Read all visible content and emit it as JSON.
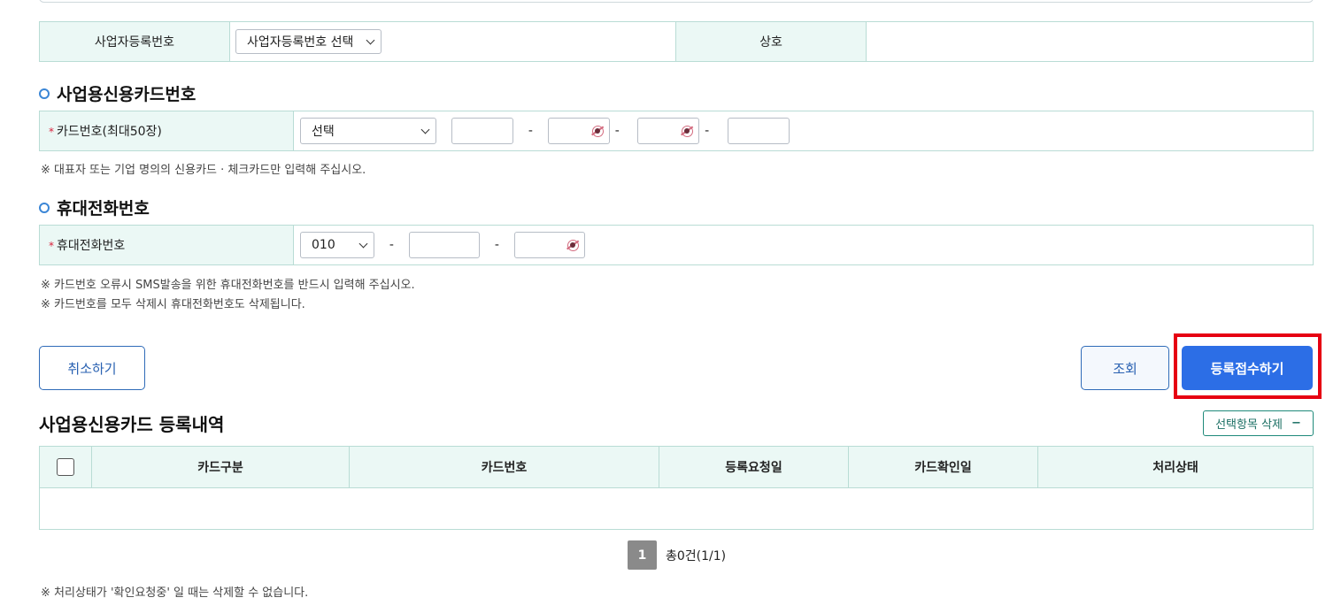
{
  "business": {
    "reg_no_label": "사업자등록번호",
    "reg_no_select": "사업자등록번호 선택",
    "company_label": "상호",
    "company_value": ""
  },
  "card_section": {
    "title": "사업용신용카드번호",
    "label": "카드번호(최대50장)",
    "required_mark": "*",
    "card_type_select": "선택",
    "separators": [
      "-",
      "-",
      "-"
    ],
    "note": "※ 대표자 또는 기업 명의의 신용카드 · 체크카드만 입력해 주십시오."
  },
  "phone_section": {
    "title": "휴대전화번호",
    "label": "휴대전화번호",
    "required_mark": "*",
    "prefix_select": "010",
    "separators": [
      "-",
      "-"
    ],
    "notes": [
      "※ 카드번호 오류시 SMS발송을 위한 휴대전화번호를 반드시 입력해 주십시오.",
      "※ 카드번호를 모두 삭제시 휴대전화번호도 삭제됩니다."
    ]
  },
  "buttons": {
    "cancel": "취소하기",
    "lookup": "조회",
    "submit": "등록접수하기"
  },
  "list": {
    "title": "사업용신용카드 등록내역",
    "delete_selected": "선택항목 삭제",
    "delete_icon": "minus-icon",
    "columns": [
      "카드구분",
      "카드번호",
      "등록요청일",
      "카드확인일",
      "처리상태"
    ],
    "rows": []
  },
  "pagination": {
    "current_page": "1",
    "total_text": "총0건(1/1)"
  },
  "footer_note": "※ 처리상태가 '확인요청중' 일 때는 삭제할 수 없습니다.",
  "colors": {
    "primary": "#2c6ee6",
    "header_bg": "#ebf8f5",
    "border": "#b9dcd5",
    "highlight": "#e60012"
  }
}
